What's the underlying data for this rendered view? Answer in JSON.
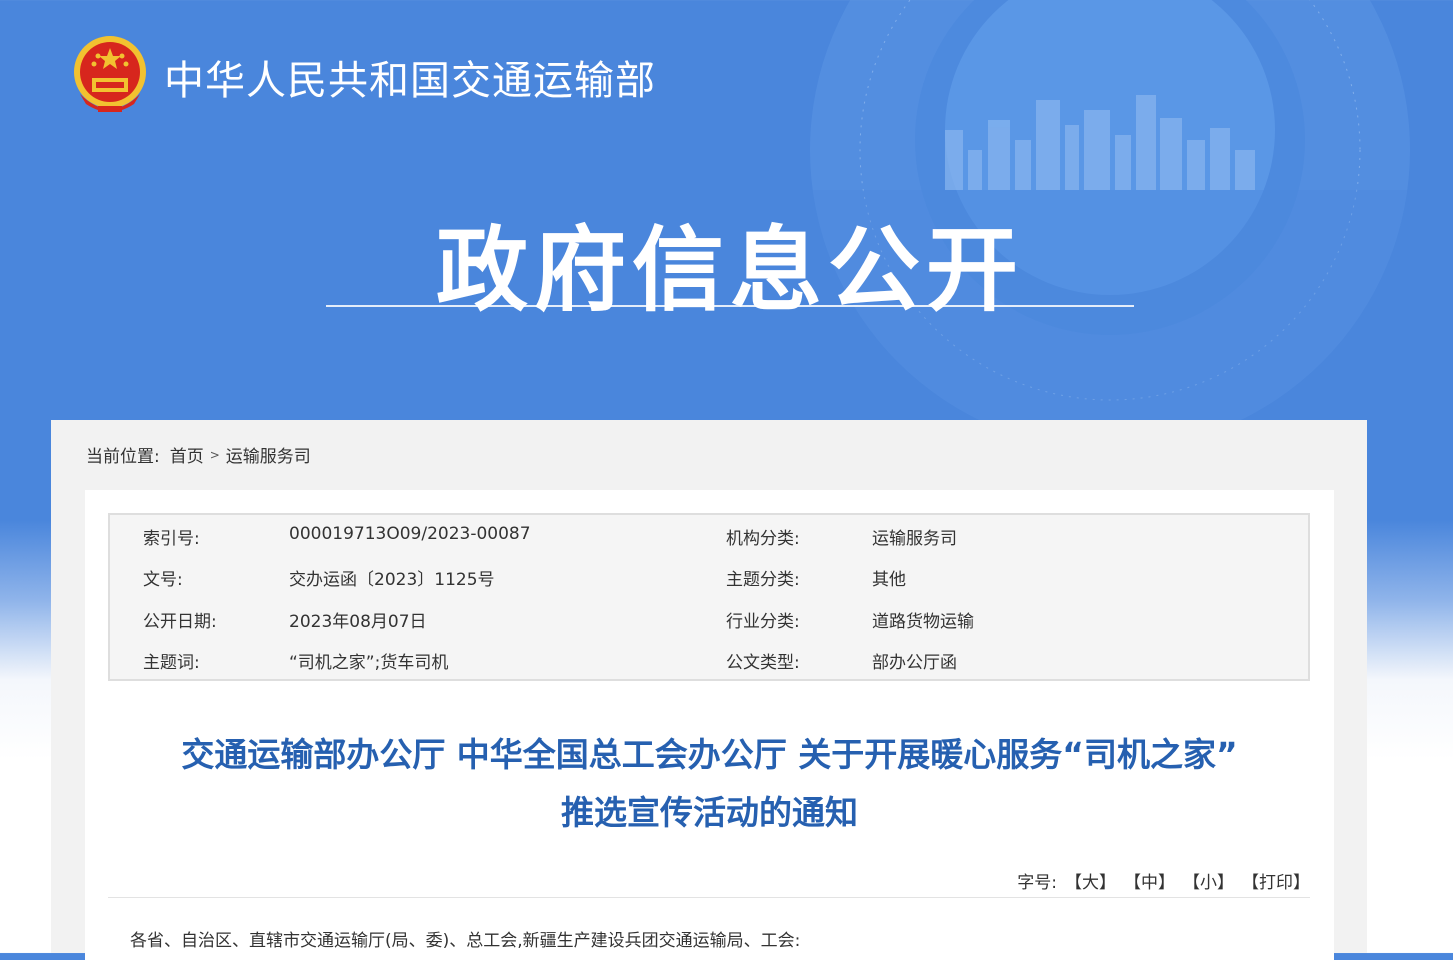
{
  "header": {
    "ministry_name": "中华人民共和国交通运输部",
    "section_title": "政府信息公开"
  },
  "breadcrumb": {
    "prefix": "当前位置:",
    "home": "首页",
    "separator": ">",
    "current": "运输服务司"
  },
  "metadata": [
    {
      "label": "索引号:",
      "value": "000019713O09/2023-00087"
    },
    {
      "label": "机构分类:",
      "value": "运输服务司"
    },
    {
      "label": "文号:",
      "value": "交办运函〔2023〕1125号"
    },
    {
      "label": "主题分类:",
      "value": "其他"
    },
    {
      "label": "公开日期:",
      "value": "2023年08月07日"
    },
    {
      "label": "行业分类:",
      "value": "道路货物运输"
    },
    {
      "label": "主题词:",
      "value": "“司机之家”;货车司机"
    },
    {
      "label": "公文类型:",
      "value": "部办公厅函"
    }
  ],
  "document": {
    "title_line1": "交通运输部办公厅 中华全国总工会办公厅 关于开展暖心服务“司机之家”",
    "title_line2": "推选宣传活动的通知",
    "salutation": "各省、自治区、直辖市交通运输厅(局、委)、总工会,新疆生产建设兵团交通运输局、工会:"
  },
  "font_size_controls": {
    "label": "字号:",
    "large": "【大】",
    "medium": "【中】",
    "small": "【小】",
    "print": "【打印】"
  },
  "colors": {
    "banner_blue": "#4a86dc",
    "title_blue": "#2660b0",
    "emblem_red": "#d7261d",
    "emblem_gold": "#f2c230"
  }
}
